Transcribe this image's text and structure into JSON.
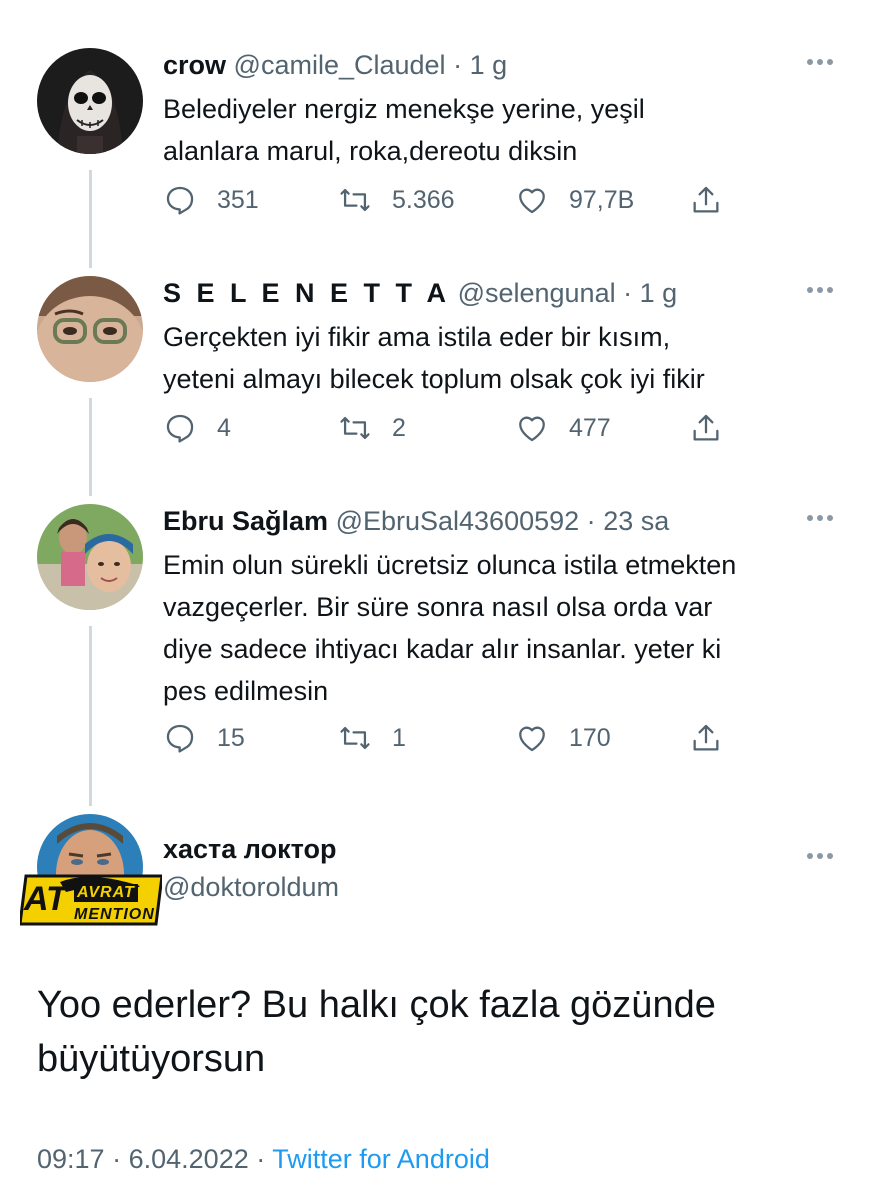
{
  "replies": [
    {
      "name": "crow",
      "handle": "@camile_Claudel",
      "separator": "·",
      "time": "1 g",
      "text": [
        "Belediyeler nergiz menekşe yerine, yeşil",
        "alanlara marul, roka,dereotu diksin"
      ],
      "stats": {
        "replies": "351",
        "retweets": "5.366",
        "likes": "97,7B"
      }
    },
    {
      "name": "S E L E N E T T A",
      "handle": "@selengunal",
      "separator": "·",
      "time": "1 g",
      "text": [
        "Gerçekten iyi fikir ama istila eder bir kısım,",
        "yeteni almayı bilecek toplum olsak çok iyi fikir"
      ],
      "stats": {
        "replies": "4",
        "retweets": "2",
        "likes": "477"
      }
    },
    {
      "name": "Ebru Sağlam",
      "handle": "@EbruSal43600592",
      "separator": "·",
      "time": "23 sa",
      "text": [
        "Emin olun sürekli ücretsiz olunca istila etmekten",
        "vazgeçerler. Bir süre sonra nasıl olsa orda var",
        "diye sadece ihtiyacı kadar alır insanlar. yeter ki",
        "pes edilmesin"
      ],
      "stats": {
        "replies": "15",
        "retweets": "1",
        "likes": "170"
      }
    }
  ],
  "main_tweet": {
    "name": "хаста локтор",
    "handle": "@doktoroldum",
    "logo_text_top": "AVRAT",
    "logo_text_left": "AT",
    "logo_text_bottom": "MENTION",
    "text_lines": [
      "Yoo ederler? Bu halkı çok fazla gözünde",
      "büyütüyorsun"
    ],
    "time": "09:17",
    "separator1": "·",
    "date": "6.04.2022",
    "separator2": "·",
    "source": "Twitter for Android"
  },
  "colors": {
    "text": "#0f1419",
    "secondary": "#536471",
    "link": "#1d9bf0",
    "thread_line": "#cfd9de",
    "logo_yellow": "#f4d000"
  },
  "icons": [
    "reply-icon",
    "retweet-icon",
    "like-icon",
    "share-icon",
    "more-icon"
  ]
}
